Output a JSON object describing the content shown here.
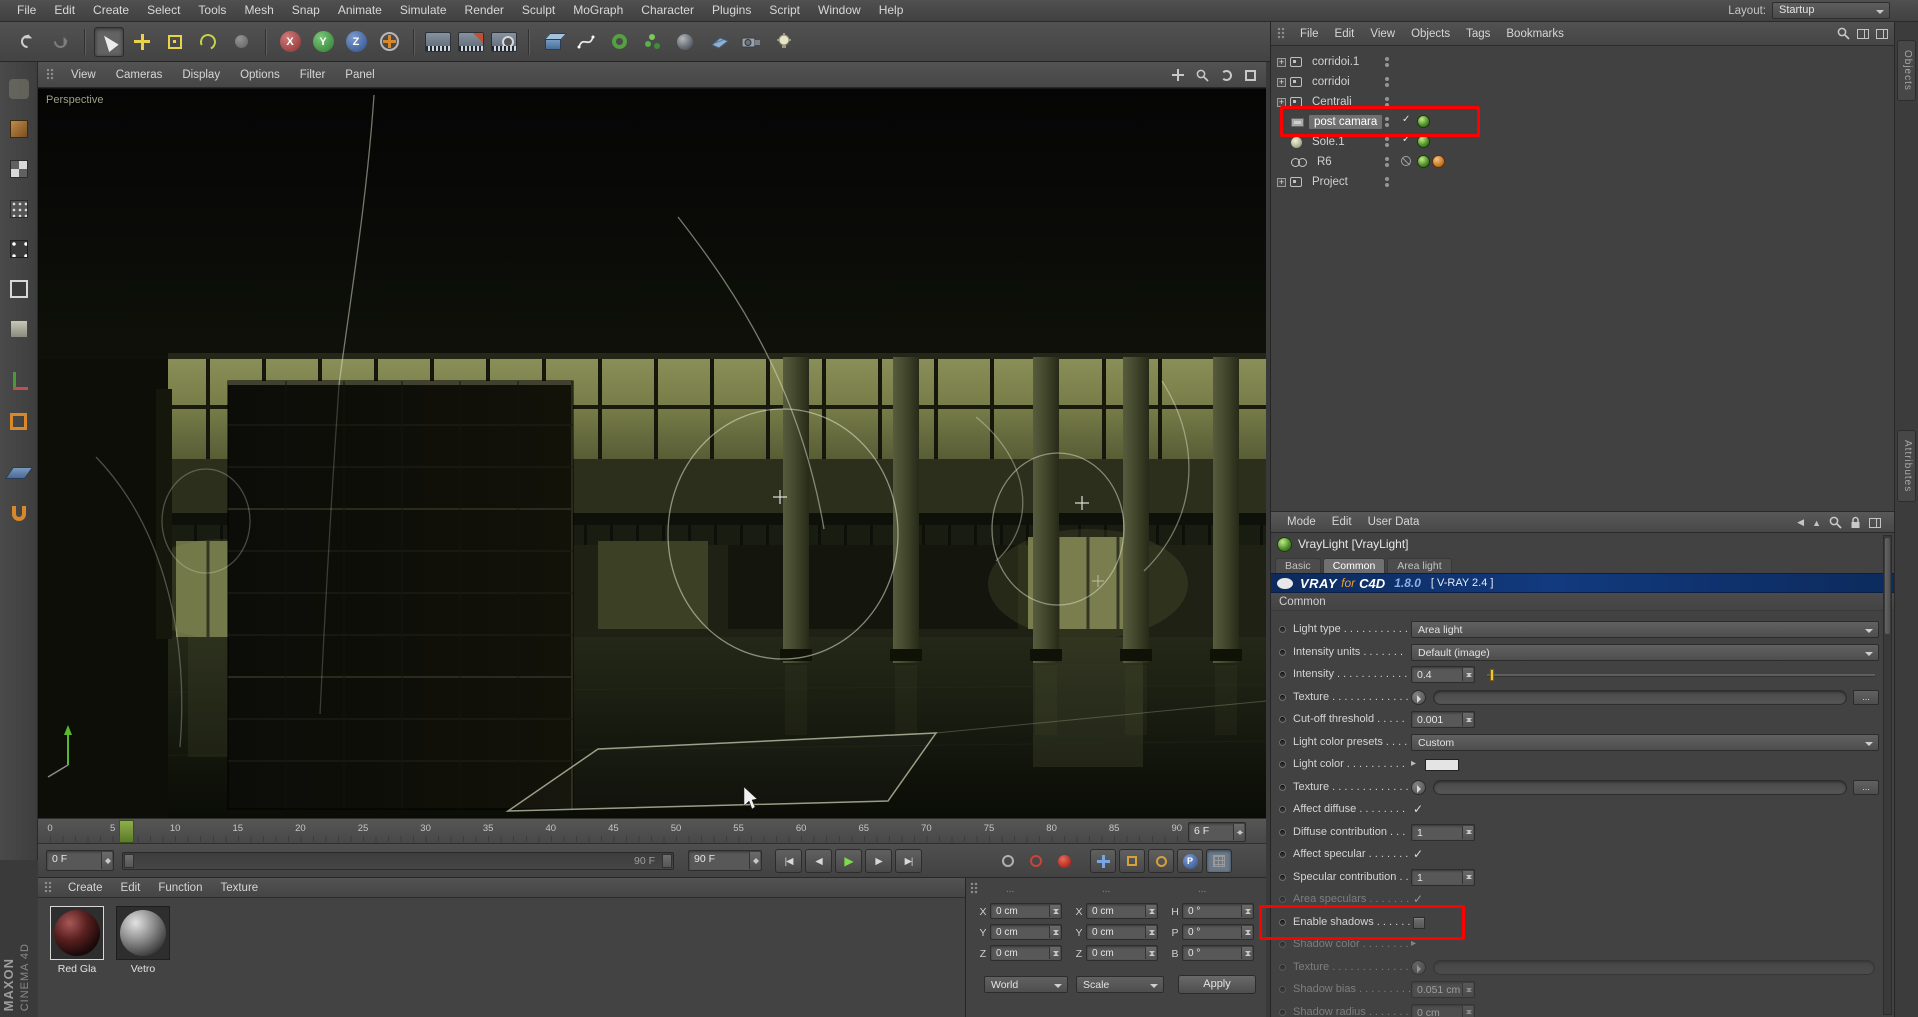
{
  "menubar": {
    "items": [
      "File",
      "Edit",
      "Create",
      "Select",
      "Tools",
      "Mesh",
      "Snap",
      "Animate",
      "Simulate",
      "Render",
      "Sculpt",
      "MoGraph",
      "Character",
      "Plugins",
      "Script",
      "Window",
      "Help"
    ],
    "layout_label": "Layout:",
    "layout_value": "Startup"
  },
  "toolbar_icons": [
    "undo",
    "redo",
    "live-selection",
    "move",
    "scale",
    "rotate",
    "last-tool",
    "lock-x",
    "lock-y",
    "lock-z",
    "coordinate-system",
    "render-view",
    "render-settings",
    "render-queue",
    "add-cube",
    "spline-pen",
    "subdivision-surface",
    "mograph",
    "environment",
    "floor",
    "camera",
    "light"
  ],
  "sidebar_icons": [
    "make-editable",
    "model-mode",
    "texture-mode",
    "uv-mode",
    "points-mode",
    "edges-mode",
    "polygons-mode",
    "object-axis",
    "texture-axis",
    "workplane",
    "snap"
  ],
  "viewport": {
    "title": "Perspective",
    "menu": [
      "View",
      "Cameras",
      "Display",
      "Options",
      "Filter",
      "Panel"
    ]
  },
  "timeline": {
    "tick_start": 0,
    "tick_end": 90,
    "tick_step": 5,
    "current_frame": 6,
    "current_frame_label": "6 F",
    "range_start": "0 F",
    "range_end": "90 F",
    "slider_label": "90 F"
  },
  "materials": {
    "menu": [
      "Create",
      "Edit",
      "Function",
      "Texture"
    ],
    "items": [
      {
        "name": "Red Gla"
      },
      {
        "name": "Vetro"
      }
    ]
  },
  "coordinates": {
    "headers": [
      "...",
      "...",
      "..."
    ],
    "rows": [
      {
        "c": [
          {
            "l": "X",
            "v": "0 cm"
          },
          {
            "l": "X",
            "v": "0 cm"
          },
          {
            "l": "H",
            "v": "0 °"
          }
        ]
      },
      {
        "c": [
          {
            "l": "Y",
            "v": "0 cm"
          },
          {
            "l": "Y",
            "v": "0 cm"
          },
          {
            "l": "P",
            "v": "0 °"
          }
        ]
      },
      {
        "c": [
          {
            "l": "Z",
            "v": "0 cm"
          },
          {
            "l": "Z",
            "v": "0 cm"
          },
          {
            "l": "B",
            "v": "0 °"
          }
        ]
      }
    ],
    "mode_dropdown": "World",
    "scale_dropdown": "Scale",
    "apply_button": "Apply"
  },
  "object_manager": {
    "menu": [
      "File",
      "Edit",
      "View",
      "Objects",
      "Tags",
      "Bookmarks"
    ],
    "objects": [
      {
        "name": "corridoi.1",
        "icon": "null",
        "expand": true
      },
      {
        "name": "corridoi",
        "icon": "null",
        "expand": true
      },
      {
        "name": "Centrali",
        "icon": "null",
        "expand": true
      },
      {
        "name": "post camara",
        "icon": "display",
        "selected": true,
        "check": true,
        "tags": [
          "vray-green"
        ]
      },
      {
        "name": "Sole.1",
        "icon": "light",
        "check": true,
        "tags": [
          "vray-green"
        ]
      },
      {
        "name": "R6",
        "icon": "instance",
        "cross": true,
        "tags": [
          "vray-green",
          "vray-orange"
        ]
      },
      {
        "name": "Project",
        "icon": "null",
        "expand": true
      }
    ]
  },
  "attributes": {
    "menu": [
      "Mode",
      "Edit",
      "User Data"
    ],
    "title": "VrayLight [VrayLight]",
    "tabs": [
      {
        "label": "Basic",
        "active": false
      },
      {
        "label": "Common",
        "active": true
      },
      {
        "label": "Area light",
        "active": false
      }
    ],
    "banner": {
      "vray": "VRAY",
      "for_": "for",
      "c4d": "C4D",
      "version": "1.8.0",
      "release": "[ V-RAY 2.4 ]"
    },
    "section": "Common",
    "rows": [
      {
        "label": "Light type . . . . . . . . . . .",
        "type": "dropdown",
        "value": "Area light"
      },
      {
        "label": "Intensity units . . . . . . .",
        "type": "dropdown",
        "value": "Default (image)"
      },
      {
        "label": "Intensity . . . . . . . . . . . .",
        "type": "number-slider",
        "value": "0.4"
      },
      {
        "label": "Texture . . . . . . . . . . . . .",
        "type": "texture",
        "dots_btn": true
      },
      {
        "label": "Cut-off threshold . . . . .",
        "type": "number",
        "value": "0.001"
      },
      {
        "label": "Light color presets . . . .",
        "type": "dropdown",
        "value": "Custom"
      },
      {
        "label": "Light color . . . . . . . . . .",
        "type": "color",
        "value": "#e4e4e4"
      },
      {
        "label": "Texture . . . . . . . . . . . . .",
        "type": "texture",
        "dots_btn": true
      },
      {
        "label": "Affect diffuse . . . . . . . .",
        "type": "check",
        "checked": true
      },
      {
        "label": "Diffuse contribution . . .",
        "type": "number",
        "value": "1"
      },
      {
        "label": "Affect specular . . . . . . .",
        "type": "check",
        "checked": true
      },
      {
        "label": "Specular contribution . .",
        "type": "number",
        "value": "1"
      },
      {
        "label": "Area speculars . . . . . . .",
        "type": "check",
        "checked": true,
        "dim": true
      },
      {
        "label": "Enable shadows . . . . . .",
        "type": "checkbox-box",
        "checked": false
      },
      {
        "label": "Shadow color . . . . . . . .",
        "type": "color-arrow",
        "dim": true
      },
      {
        "label": "Texture . . . . . . . . . . . . .",
        "type": "texture",
        "dim": true
      },
      {
        "label": "Shadow bias . . . . . . . . .",
        "type": "number",
        "value": "0.051 cm",
        "dim": true
      },
      {
        "label": "Shadow radius . . . . . . .",
        "type": "number",
        "value": "0 cm",
        "dim": true
      }
    ]
  },
  "side_strip": {
    "tabs": [
      "Objects",
      "Attributes"
    ]
  },
  "branding": {
    "maxon": "MAXON",
    "cinema": "CINEMA 4D"
  },
  "glyphs": {
    "transport": {
      "goto_start": "|◀",
      "prev_frame": "◀",
      "play": "▶",
      "next_frame": "▶",
      "goto_end": "▶|"
    },
    "axis": {
      "x": "X",
      "y": "Y",
      "z": "Z"
    },
    "param_key": "P",
    "expand": "+",
    "check": "✓",
    "arrow": "▸",
    "dots_button": "..."
  },
  "annotations": [
    {
      "target": "post camara object row",
      "color": "#ff0000"
    },
    {
      "target": "Enable shadows row",
      "color": "#ff0000"
    }
  ]
}
